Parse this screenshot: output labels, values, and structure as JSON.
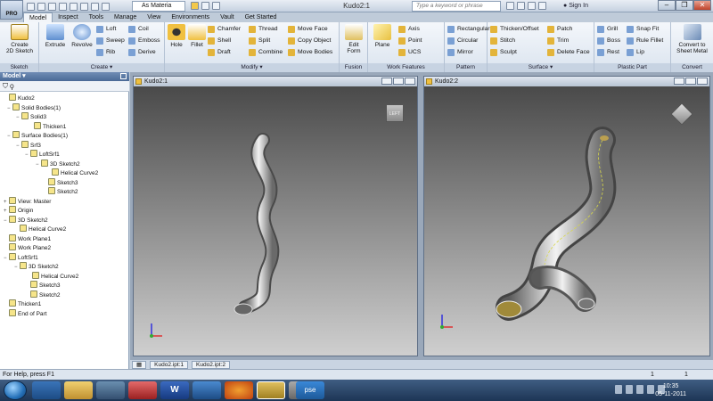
{
  "app": {
    "logo_text": "PRO",
    "window_title": "Kudo2:1",
    "material": "As Materia",
    "search_placeholder": "Type a keyword or phrase",
    "sign_in": "Sign In"
  },
  "tabs": [
    "Model",
    "Inspect",
    "Tools",
    "Manage",
    "View",
    "Environments",
    "Vault",
    "Get Started"
  ],
  "ribbon": {
    "sketch": {
      "label": "Sketch",
      "create_2d": "Create\n2D Sketch"
    },
    "create": {
      "label": "Create",
      "extrude": "Extrude",
      "revolve": "Revolve",
      "loft": "Loft",
      "sweep": "Sweep",
      "rib": "Rib",
      "coil": "Coil",
      "emboss": "Emboss",
      "derive": "Derive"
    },
    "modify": {
      "label": "Modify",
      "hole": "Hole",
      "fillet": "Fillet",
      "chamfer": "Chamfer",
      "shell": "Shell",
      "draft": "Draft",
      "thread": "Thread",
      "split": "Split",
      "combine": "Combine",
      "move_face": "Move Face",
      "copy_object": "Copy Object",
      "move_bodies": "Move Bodies"
    },
    "fusion": {
      "label": "Fusion",
      "edit_form": "Edit\nForm"
    },
    "work": {
      "label": "Work Features",
      "plane": "Plane",
      "axis": "Axis",
      "point": "Point",
      "ucs": "UCS"
    },
    "pattern": {
      "label": "Pattern",
      "rectangular": "Rectangular",
      "circular": "Circular",
      "mirror": "Mirror"
    },
    "surface": {
      "label": "Surface",
      "thicken": "Thicken/Offset",
      "stitch": "Stitch",
      "sculpt": "Sculpt",
      "patch": "Patch",
      "trim": "Trim",
      "delete_face": "Delete Face"
    },
    "plastic": {
      "label": "Plastic Part",
      "grill": "Grill",
      "boss": "Boss",
      "rest": "Rest",
      "snap_fit": "Snap Fit",
      "rule_fillet": "Rule Fillet",
      "lip": "Lip"
    },
    "convert": {
      "label": "Convert",
      "sheet_metal": "Convert to\nSheet Metal"
    }
  },
  "browser": {
    "title": "Model",
    "tree": [
      {
        "label": "Kudo2",
        "x": 4,
        "exp": ""
      },
      {
        "label": "Solid Bodies(1)",
        "x": 8,
        "exp": "−"
      },
      {
        "label": "Solid3",
        "x": 18,
        "exp": "−"
      },
      {
        "label": "Thicken1",
        "x": 32,
        "exp": ""
      },
      {
        "label": "Surface Bodies(1)",
        "x": 8,
        "exp": "−"
      },
      {
        "label": "Srf3",
        "x": 18,
        "exp": "−"
      },
      {
        "label": "LoftSrf1",
        "x": 28,
        "exp": "−"
      },
      {
        "label": "3D Sketch2",
        "x": 40,
        "exp": "−"
      },
      {
        "label": "Helical Curve2",
        "x": 52,
        "exp": ""
      },
      {
        "label": "Sketch3",
        "x": 48,
        "exp": ""
      },
      {
        "label": "Sketch2",
        "x": 48,
        "exp": ""
      },
      {
        "label": "View: Master",
        "x": 4,
        "exp": "+"
      },
      {
        "label": "Origin",
        "x": 4,
        "exp": "+"
      },
      {
        "label": "3D Sketch2",
        "x": 4,
        "exp": "−"
      },
      {
        "label": "Helical Curve2",
        "x": 16,
        "exp": ""
      },
      {
        "label": "Work Plane1",
        "x": 4,
        "exp": ""
      },
      {
        "label": "Work Plane2",
        "x": 4,
        "exp": ""
      },
      {
        "label": "LoftSrf1",
        "x": 4,
        "exp": "−"
      },
      {
        "label": "3D Sketch2",
        "x": 16,
        "exp": "−"
      },
      {
        "label": "Helical Curve2",
        "x": 30,
        "exp": ""
      },
      {
        "label": "Sketch3",
        "x": 28,
        "exp": ""
      },
      {
        "label": "Sketch2",
        "x": 28,
        "exp": ""
      },
      {
        "label": "Thicken1",
        "x": 4,
        "exp": ""
      },
      {
        "label": "End of Part",
        "x": 4,
        "exp": ""
      }
    ]
  },
  "views": [
    {
      "title": "Kudo2:1",
      "cube": "LEFT"
    },
    {
      "title": "Kudo2:2",
      "cube": ""
    }
  ],
  "doc_tabs": [
    "Kudo2.ipt:1",
    "Kudo2.ipt:2"
  ],
  "status": {
    "text": "For Help, press F1",
    "n1": "1",
    "n2": "1"
  },
  "clock": {
    "time": "10:35",
    "date": "05-11-2011"
  }
}
